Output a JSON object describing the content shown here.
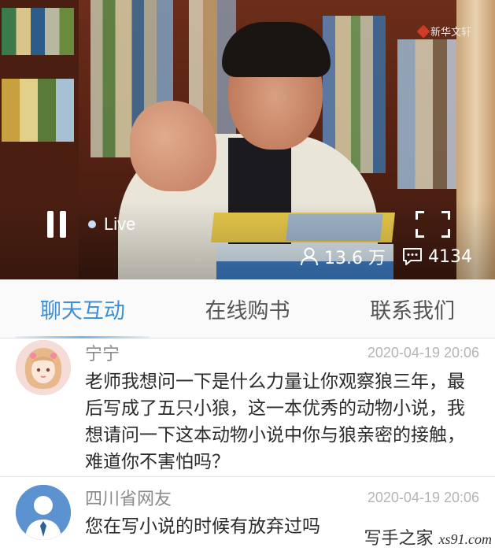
{
  "video": {
    "watermark": "新华文轩",
    "live_label": "Live",
    "viewers": "13.6 万",
    "comments": "4134",
    "icons": {
      "pause": "pause-icon",
      "fullscreen": "fullscreen-icon",
      "viewers": "user-icon",
      "comments": "comment-icon"
    }
  },
  "tabs": [
    {
      "label": "聊天互动",
      "active": true
    },
    {
      "label": "在线购书",
      "active": false
    },
    {
      "label": "联系我们",
      "active": false
    }
  ],
  "messages": [
    {
      "name": "宁宁",
      "time": "2020-04-19 20:06",
      "text": "老师我想问一下是什么力量让你观察狼三年，最后写成了五只小狼，这一本优秀的动物小说，我想请问一下这本动物小说中你与狼亲密的接触，难道你不害怕吗？"
    },
    {
      "name": "四川省网友",
      "time": "2020-04-19 20:06",
      "text": "您在写小说的时候有放弃过吗"
    }
  ],
  "footer_watermark": {
    "text": "写手之家",
    "sub": "xs91.com"
  },
  "colors": {
    "accent": "#3a8fd6",
    "text": "#2b2b2b",
    "muted": "#8a8a8a"
  }
}
